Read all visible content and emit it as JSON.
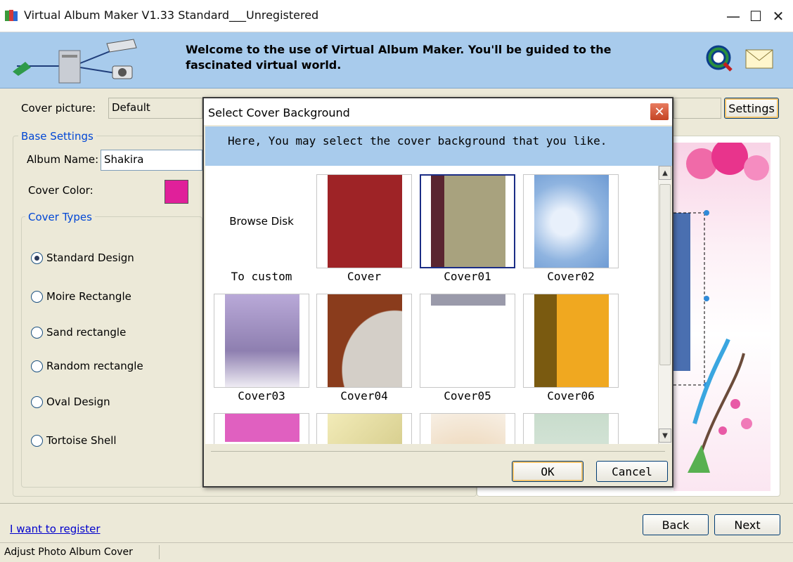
{
  "window": {
    "title": "Virtual Album Maker V1.33 Standard___Unregistered",
    "minimize": "—",
    "maximize": "☐",
    "close": "✕"
  },
  "banner": {
    "welcome": "Welcome to the use of Virtual Album Maker. You'll be guided to the fascinated virtual world."
  },
  "form": {
    "cover_picture_label": "Cover picture:",
    "cover_picture_value": "Default",
    "settings_button": "Settings",
    "base_settings_title": "Base Settings",
    "album_name_label": "Album Name:",
    "album_name_value": "Shakira",
    "cover_color_label": "Cover Color:",
    "cover_color_swatch": "#e0209a",
    "cover_types_title": "Cover Types",
    "cover_types": [
      {
        "label": "Standard Design",
        "checked": true
      },
      {
        "label": "Moire Rectangle",
        "checked": false
      },
      {
        "label": "Sand rectangle",
        "checked": false
      },
      {
        "label": "Random rectangle",
        "checked": false
      },
      {
        "label": "Oval Design",
        "checked": false
      },
      {
        "label": "Tortoise Shell",
        "checked": false
      }
    ]
  },
  "footer": {
    "register_link": "I want to register",
    "back_button": "Back",
    "next_button": "Next",
    "status_text": "Adjust Photo Album Cover"
  },
  "dialog": {
    "title": "Select Cover Background",
    "close": "✕",
    "instruction": "Here, You may select the cover background that you like.",
    "browse_label": "Browse Disk",
    "custom_caption": "To custom",
    "thumbnails": [
      {
        "caption": "Cover",
        "selected": false
      },
      {
        "caption": "Cover01",
        "selected": true
      },
      {
        "caption": "Cover02",
        "selected": false
      },
      {
        "caption": "Cover03",
        "selected": false
      },
      {
        "caption": "Cover04",
        "selected": false
      },
      {
        "caption": "Cover05",
        "selected": false
      },
      {
        "caption": "Cover06",
        "selected": false
      }
    ],
    "ok_button": "OK",
    "cancel_button": "Cancel"
  }
}
